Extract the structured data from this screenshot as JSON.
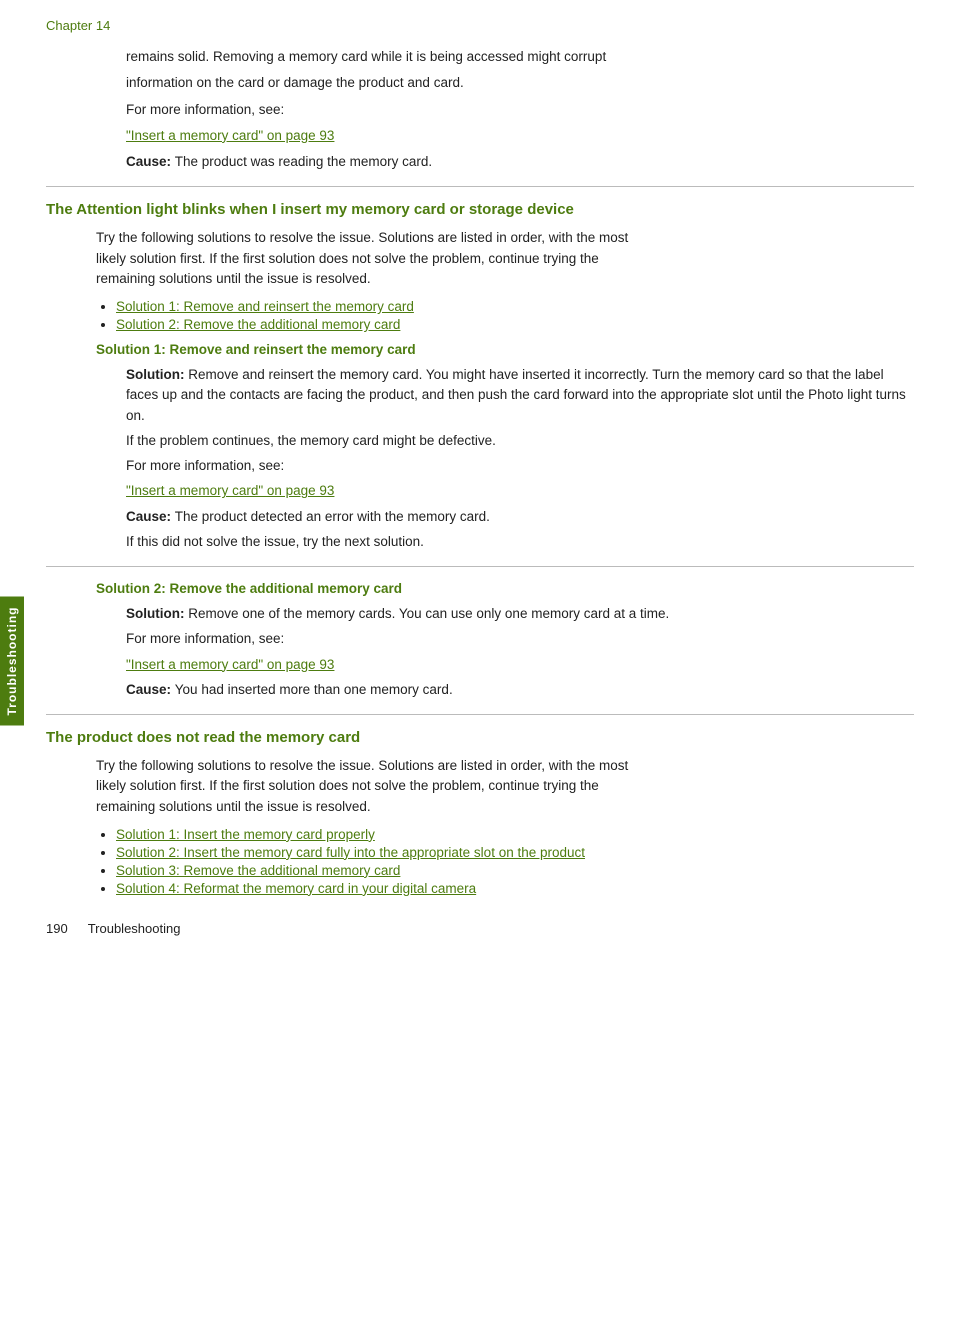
{
  "chapter": {
    "label": "Chapter 14"
  },
  "sidebar": {
    "label": "Troubleshooting"
  },
  "intro": {
    "line1": "remains solid. Removing a memory card while it is being accessed might corrupt",
    "line2": "information on the card or damage the product and card.",
    "for_more": "For more information, see:",
    "link1": "\"Insert a memory card\" on page 93",
    "cause_label": "Cause:",
    "cause_text": "The product was reading the memory card."
  },
  "section1": {
    "heading": "The Attention light blinks when I insert my memory card or storage device",
    "intro1": "Try the following solutions to resolve the issue. Solutions are listed in order, with the most",
    "intro2": "likely solution first. If the first solution does not solve the problem, continue trying the",
    "intro3": "remaining solutions until the issue is resolved.",
    "bullets": [
      "Solution 1: Remove and reinsert the memory card",
      "Solution 2: Remove the additional memory card"
    ],
    "sub1": {
      "heading": "Solution 1: Remove and reinsert the memory card",
      "solution_label": "Solution:",
      "solution_text": "Remove and reinsert the memory card. You might have inserted it incorrectly. Turn the memory card so that the label faces up and the contacts are facing the product, and then push the card forward into the appropriate slot until the Photo light turns on.",
      "if_problem": "If the problem continues, the memory card might be defective.",
      "for_more": "For more information, see:",
      "link": "\"Insert a memory card\" on page 93",
      "cause_label": "Cause:",
      "cause_text": "The product detected an error with the memory card.",
      "if_not": "If this did not solve the issue, try the next solution."
    },
    "sub2": {
      "heading": "Solution 2: Remove the additional memory card",
      "solution_label": "Solution:",
      "solution_text": "Remove one of the memory cards. You can use only one memory card at a time.",
      "for_more": "For more information, see:",
      "link": "\"Insert a memory card\" on page 93",
      "cause_label": "Cause:",
      "cause_text": "You had inserted more than one memory card."
    }
  },
  "section2": {
    "heading": "The product does not read the memory card",
    "intro1": "Try the following solutions to resolve the issue. Solutions are listed in order, with the most",
    "intro2": "likely solution first. If the first solution does not solve the problem, continue trying the",
    "intro3": "remaining solutions until the issue is resolved.",
    "bullets": [
      "Solution 1: Insert the memory card properly",
      "Solution 2: Insert the memory card fully into the appropriate slot on the product",
      "Solution 3: Remove the additional memory card",
      "Solution 4: Reformat the memory card in your digital camera"
    ]
  },
  "footer": {
    "page_number": "190",
    "label": "Troubleshooting"
  }
}
